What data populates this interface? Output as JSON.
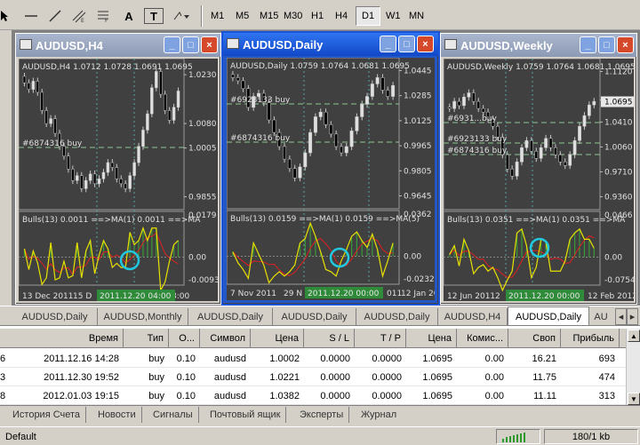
{
  "toolbar": {
    "timeframes": [
      "M1",
      "M5",
      "M15",
      "M30",
      "H1",
      "H4",
      "D1",
      "W1",
      "MN"
    ],
    "active_timeframe": "D1",
    "icons": [
      "cursor-icon",
      "crosshair-icon",
      "hline-icon",
      "trendline-icon",
      "fibo-channel-icon",
      "fibo-icon",
      "text-a-icon",
      "text-label-icon",
      "arrows-icon"
    ],
    "a_label": "A",
    "t_label": "T"
  },
  "windows": [
    {
      "title": "AUDUSD,H4",
      "info": "AUDUSD,H4  1.0712 1.0728 1.0691 1.0695",
      "order_label": "#6874316 buy",
      "price_ticks": [
        "1.0230",
        "1.0080",
        "1.0005",
        "0.9855"
      ],
      "current_price": "",
      "indicator_label": "Bulls(13) 0.0011 ==>MA(1) 0.0011 ==>MA",
      "ind_ticks": [
        "0.0179",
        "0.00",
        "-0.0093"
      ],
      "date_labels": [
        "13 Dec 2011",
        "15 D",
        "8:00"
      ],
      "highlight_date": "2011.12.20 04:00",
      "close_series": [
        1.0205,
        1.0185,
        1.021,
        1.0176,
        1.012,
        1.008,
        1.0095,
        1.005,
        1.001,
        0.998,
        0.994,
        0.9905,
        0.992,
        0.988,
        0.9905,
        0.9925,
        0.9895,
        0.991,
        0.993,
        0.996,
        0.9945,
        0.991,
        0.9895,
        0.988,
        0.992,
        0.996,
        1.001,
        1.006,
        1.011,
        1.019,
        1.024,
        1.017,
        1.012,
        1.009,
        1.013,
        1.018
      ]
    },
    {
      "title": "AUDUSD,Daily",
      "info": "AUDUSD,Daily  1.0759 1.0764 1.0681 1.0695",
      "order_label": "#6923133 buy",
      "order_label2": "#6874316 buy",
      "price_ticks": [
        "1.0445",
        "1.0285",
        "1.0125",
        "0.9965",
        "0.9805",
        "0.9645"
      ],
      "current_price": "",
      "indicator_label": "Bulls(13) 0.0159 ==>MA(1) 0.0159 ==>MA(5)",
      "ind_ticks": [
        "0.0362",
        "0.00",
        "-0.0232"
      ],
      "date_labels": [
        "7 Nov 2011",
        "29 N",
        "011",
        "12 Jan 20"
      ],
      "highlight_date": "2011.12.20 00:00",
      "close_series": [
        1.04,
        1.038,
        1.033,
        1.021,
        1.028,
        1.03,
        1.024,
        1.013,
        1.005,
        0.996,
        0.988,
        0.982,
        0.976,
        0.983,
        0.992,
        1.005,
        1.015,
        1.018,
        1.01,
        1.004,
        0.996,
        0.992,
        0.996,
        1.006,
        1.015,
        1.023,
        1.028,
        1.036,
        1.04,
        1.032,
        1.028,
        1.035
      ]
    },
    {
      "title": "AUDUSD,Weekly",
      "info": "AUDUSD,Weekly  1.0759 1.0764 1.0681 1.0695",
      "order_label": "#6931...buy",
      "order_label2": "#6923133 buy",
      "order_label3": "#6874316 buy",
      "price_ticks": [
        "1.1120",
        "1.0720",
        "1.0410",
        "1.0060",
        "0.9710",
        "0.9360"
      ],
      "current_price": "1.0695",
      "indicator_label": "Bulls(13) 0.0351 ==>MA(1) 0.0351 ==>MA",
      "ind_ticks": [
        "0.0466",
        "0.00",
        "-0.0754"
      ],
      "date_labels": [
        "12 Jun 2011",
        "2",
        "12 Feb 2012"
      ],
      "highlight_date": "2011.12.20 00:00",
      "close_series": [
        1.06,
        1.07,
        1.064,
        1.076,
        1.082,
        1.07,
        1.06,
        1.055,
        1.045,
        1.035,
        1.02,
        0.995,
        0.975,
        0.965,
        0.985,
        1.005,
        1.015,
        1.0,
        0.99,
        1.005,
        1.018,
        1.005,
        0.995,
        0.985,
        0.98,
        0.995,
        1.015,
        1.035,
        1.05,
        1.065,
        1.07
      ]
    }
  ],
  "chart_tabs": [
    "AUDUSD,Daily",
    "AUDUSD,Monthly",
    "AUDUSD,Daily",
    "AUDUSD,Daily",
    "AUDUSD,Daily",
    "AUDUSD,H4",
    "AUDUSD,Daily",
    "AU"
  ],
  "active_tab_index": 6,
  "terminal": {
    "columns": [
      "Время",
      "Тип",
      "О...",
      "Символ",
      "Цена",
      "S / L",
      "T / P",
      "Цена",
      "Комис...",
      "Своп",
      "Прибыль"
    ],
    "rows": [
      [
        "2011.12.16 14:28",
        "buy",
        "0.10",
        "audusd",
        "1.0002",
        "0.0000",
        "0.0000",
        "1.0695",
        "0.00",
        "16.21",
        "693"
      ],
      [
        "2011.12.30 19:52",
        "buy",
        "0.10",
        "audusd",
        "1.0221",
        "0.0000",
        "0.0000",
        "1.0695",
        "0.00",
        "11.75",
        "474"
      ],
      [
        "2012.01.03 19:15",
        "buy",
        "0.10",
        "audusd",
        "1.0382",
        "0.0000",
        "0.0000",
        "1.0695",
        "0.00",
        "11.11",
        "313"
      ]
    ],
    "row_prefixes": [
      "6",
      "3",
      "8"
    ],
    "bottom_tabs": [
      "История Счета",
      "Новости",
      "Сигналы",
      "Почтовый ящик",
      "Эксперты",
      "Журнал"
    ]
  },
  "status": {
    "profile": "Default",
    "traffic": "180/1 kb"
  },
  "colors": {
    "chart_bg": "#404040",
    "bull_candle": "#e0e0e0",
    "bear_candle": "#000000",
    "hist": "#3a9a3a",
    "bulls_line": "#e8e000",
    "ma_line": "#e02020",
    "order_line": "#90c890",
    "circle": "#20c8e0",
    "active_title": "#1b54d6"
  }
}
